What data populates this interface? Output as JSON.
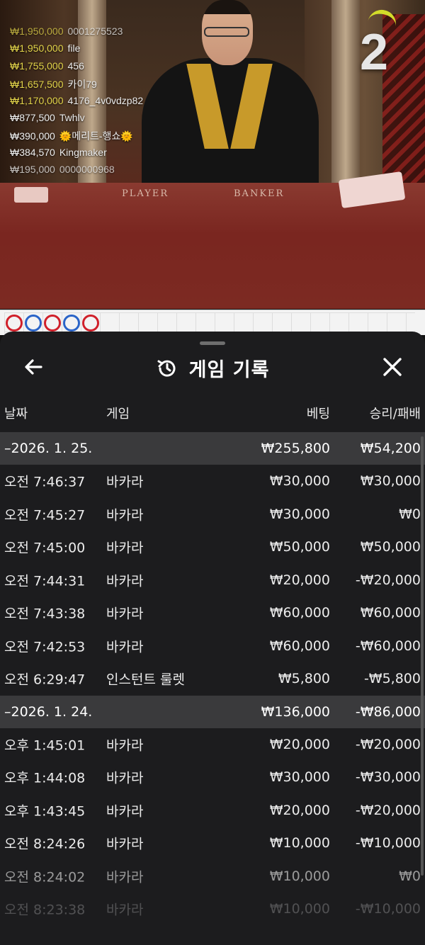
{
  "stream": {
    "round_number": "2",
    "felt_labels": [
      "PLAYER",
      "BANKER"
    ],
    "winners": [
      {
        "amount": "₩1,950,000",
        "name": "0001275523",
        "style": "gold fade"
      },
      {
        "amount": "₩1,950,000",
        "name": "file",
        "style": "gold"
      },
      {
        "amount": "₩1,755,000",
        "name": "456",
        "style": "gold"
      },
      {
        "amount": "₩1,657,500",
        "name": "카이79",
        "style": "gold"
      },
      {
        "amount": "₩1,170,000",
        "name": "4176_4v0vdzp82",
        "style": "gold"
      },
      {
        "amount": "₩877,500",
        "name": "Twhlv",
        "style": "white"
      },
      {
        "amount": "₩390,000",
        "name": "🌞메리트-행쇼🌞",
        "style": "white"
      },
      {
        "amount": "₩384,570",
        "name": "Kingmaker",
        "style": "white"
      },
      {
        "amount": "₩195,000",
        "name": "0000000968",
        "style": "white fade"
      }
    ],
    "road_beads": [
      "red",
      "blue",
      "red",
      "blue",
      "red"
    ]
  },
  "sheet": {
    "title": "게임 기록",
    "back_icon": "arrow-left-icon",
    "history_icon": "history-clock-icon",
    "close_icon": "close-icon",
    "columns": {
      "date": "날짜",
      "game": "게임",
      "bet": "베팅",
      "result": "승리/패배"
    },
    "groups": [
      {
        "date": "–2026. 1. 25.",
        "bet_total": "₩255,800",
        "result_total": "₩54,200",
        "rows": [
          {
            "time": "오전 7:46:37",
            "game": "바카라",
            "bet": "₩30,000",
            "result": "₩30,000"
          },
          {
            "time": "오전 7:45:27",
            "game": "바카라",
            "bet": "₩30,000",
            "result": "₩0"
          },
          {
            "time": "오전 7:45:00",
            "game": "바카라",
            "bet": "₩50,000",
            "result": "₩50,000"
          },
          {
            "time": "오전 7:44:31",
            "game": "바카라",
            "bet": "₩20,000",
            "result": "-₩20,000"
          },
          {
            "time": "오전 7:43:38",
            "game": "바카라",
            "bet": "₩60,000",
            "result": "₩60,000"
          },
          {
            "time": "오전 7:42:53",
            "game": "바카라",
            "bet": "₩60,000",
            "result": "-₩60,000"
          },
          {
            "time": "오전 6:29:47",
            "game": "인스턴트 룰렛",
            "bet": "₩5,800",
            "result": "-₩5,800"
          }
        ]
      },
      {
        "date": "–2026. 1. 24.",
        "bet_total": "₩136,000",
        "result_total": "-₩86,000",
        "rows": [
          {
            "time": "오후 1:45:01",
            "game": "바카라",
            "bet": "₩20,000",
            "result": "-₩20,000"
          },
          {
            "time": "오후 1:44:08",
            "game": "바카라",
            "bet": "₩30,000",
            "result": "-₩30,000"
          },
          {
            "time": "오후 1:43:45",
            "game": "바카라",
            "bet": "₩20,000",
            "result": "-₩20,000"
          },
          {
            "time": "오전 8:24:26",
            "game": "바카라",
            "bet": "₩10,000",
            "result": "-₩10,000"
          },
          {
            "time": "오전 8:24:02",
            "game": "바카라",
            "bet": "₩10,000",
            "result": "₩0"
          },
          {
            "time": "오전 8:23:38",
            "game": "바카라",
            "bet": "₩10,000",
            "result": "-₩10,000"
          }
        ]
      }
    ]
  }
}
